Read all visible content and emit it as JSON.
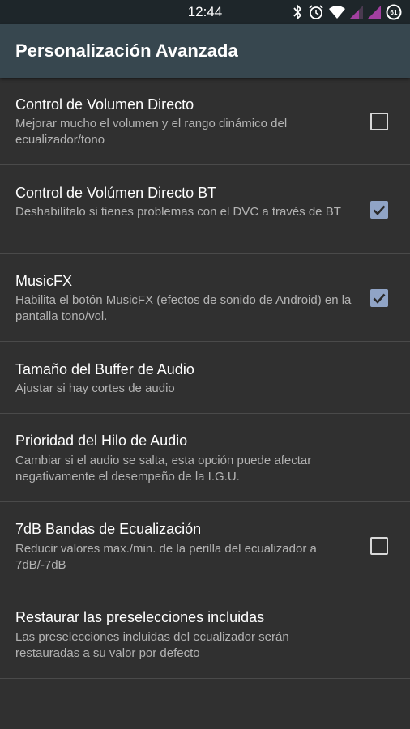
{
  "status_bar": {
    "time": "12:44",
    "battery_level": "61",
    "icons": [
      "bluetooth-icon",
      "alarm-icon",
      "wifi-icon",
      "signal-icon",
      "signal-icon",
      "battery-icon"
    ]
  },
  "app_bar": {
    "title": "Personalización Avanzada"
  },
  "settings": [
    {
      "title": "Control de Volumen Directo",
      "summary": "Mejorar mucho el volumen y el rango dinámico del ecualizador/tono",
      "checkbox": true,
      "checked": false
    },
    {
      "title": "Control de Volúmen Directo BT",
      "summary": "Deshabilítalo si tienes problemas con el DVC a través de BT",
      "checkbox": true,
      "checked": true
    },
    {
      "title": "MusicFX",
      "summary": "Habilita el botón MusicFX (efectos de sonido de Android) en la pantalla tono/vol.",
      "checkbox": true,
      "checked": true
    },
    {
      "title": "Tamaño del Buffer de Audio",
      "summary": "Ajustar si hay cortes de audio",
      "checkbox": false
    },
    {
      "title": "Prioridad del Hilo de Audio",
      "summary": "Cambiar si el audio se salta, esta opción puede afectar negativamente el desempeño de la I.G.U.",
      "checkbox": false
    },
    {
      "title": "7dB Bandas de Ecualización",
      "summary": "Reducir valores max./min. de la perilla del ecualizador a 7dB/-7dB",
      "checkbox": true,
      "checked": false
    },
    {
      "title": "Restaurar las preselecciones incluidas",
      "summary": "Las preselecciones incluidas del ecualizador serán restauradas a su valor por defecto",
      "checkbox": false
    }
  ],
  "colors": {
    "status_bar": "#1e262a",
    "app_bar": "#37474f",
    "background": "#303030",
    "checkbox_checked": "#90a4c6"
  }
}
